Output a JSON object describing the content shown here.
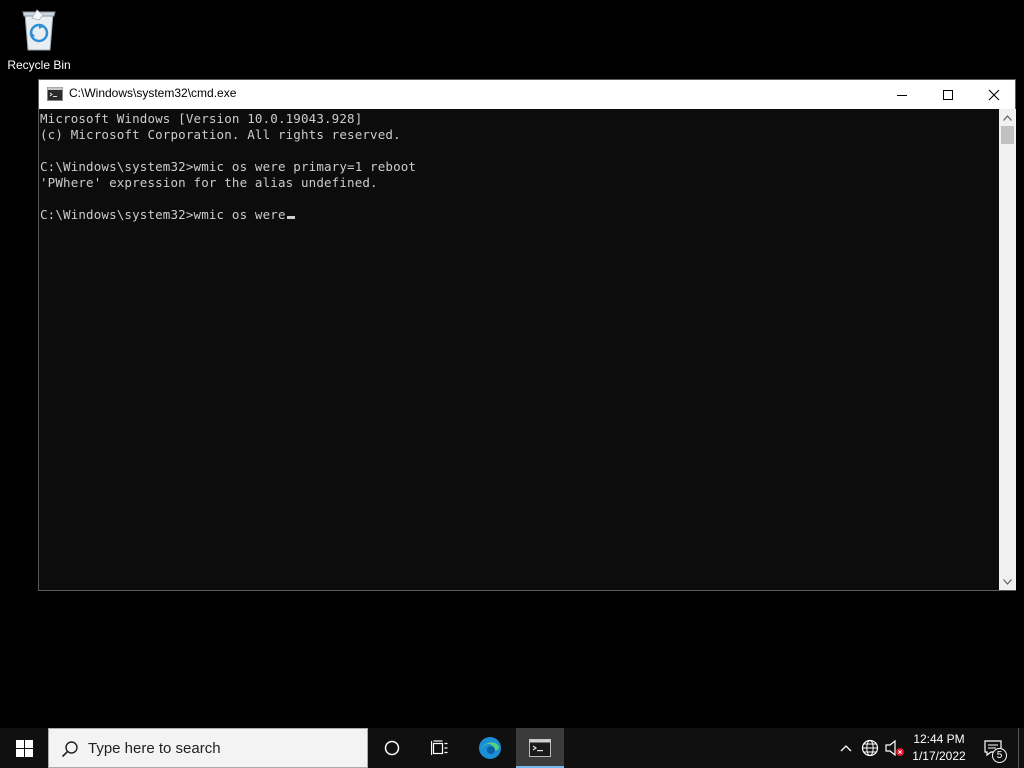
{
  "desktop": {
    "recycle_bin_label": "Recycle Bin"
  },
  "window": {
    "title": "C:\\Windows\\system32\\cmd.exe",
    "app_icon": "cmd-icon"
  },
  "console": {
    "lines": [
      "Microsoft Windows [Version 10.0.19043.928]",
      "(c) Microsoft Corporation. All rights reserved.",
      "",
      "C:\\Windows\\system32>wmic os were primary=1 reboot",
      "'PWhere' expression for the alias undefined.",
      "",
      "C:\\Windows\\system32>wmic os were"
    ]
  },
  "taskbar": {
    "search_placeholder": "Type here to search",
    "clock_time": "12:44 PM",
    "clock_date": "1/17/2022",
    "notification_count": "5"
  },
  "colors": {
    "console_bg": "#0c0c0c",
    "console_text": "#cccccc",
    "taskbar_bg": "#101010",
    "active_task_underline": "#76b9ed"
  }
}
